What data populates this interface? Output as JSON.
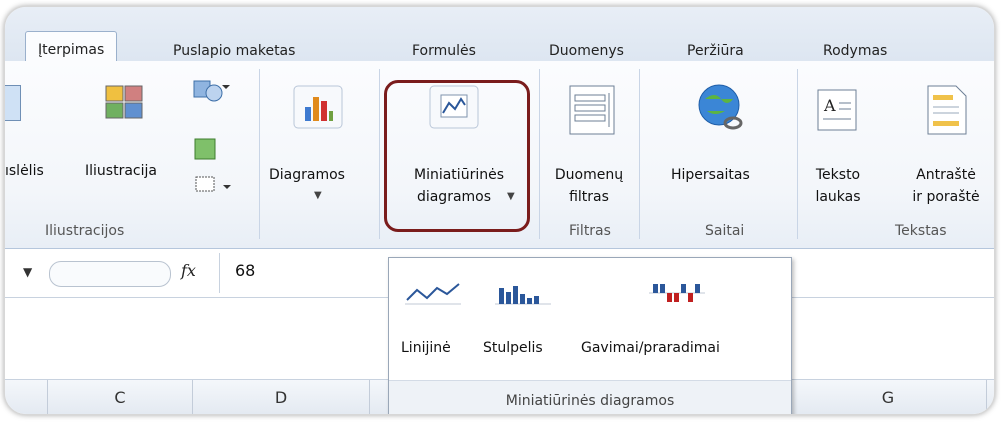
{
  "tabs": [
    {
      "label": "Įterpimas",
      "active": true
    },
    {
      "label": "Puslapio maketas",
      "active": false
    },
    {
      "label": "Formulės",
      "active": false
    },
    {
      "label": "Duomenys",
      "active": false
    },
    {
      "label": "Peržiūra",
      "active": false
    },
    {
      "label": "Rodymas",
      "active": false
    }
  ],
  "ribbon": {
    "picture_partial": "ıslėlis",
    "illustration": "Iliustracija",
    "group_illustrations": "Iliustracijos",
    "charts": "Diagramos",
    "sparklines_line1": "Miniatiūrinės",
    "sparklines_line2": "diagramos",
    "slicer_line1": "Duomenų",
    "slicer_line2": "filtras",
    "group_filter": "Filtras",
    "hyperlink": "Hipersaitas",
    "group_links": "Saitai",
    "textbox_line1": "Teksto",
    "textbox_line2": "laukas",
    "header_line1": "Antraštė",
    "header_line2": "ir poraštė",
    "group_text": "Tekstas"
  },
  "formula_bar": {
    "fx": "fx",
    "value": "68"
  },
  "columns": [
    "C",
    "D",
    "G"
  ],
  "sparkline_menu": {
    "line": "Linijinė",
    "column": "Stulpelis",
    "winloss": "Gavimai/praradimai",
    "footer": "Miniatiūrinės diagramos"
  },
  "colors": {
    "highlight": "#7a1c1c",
    "accent": "#2b579a",
    "row_red": "#f6b9b9"
  }
}
